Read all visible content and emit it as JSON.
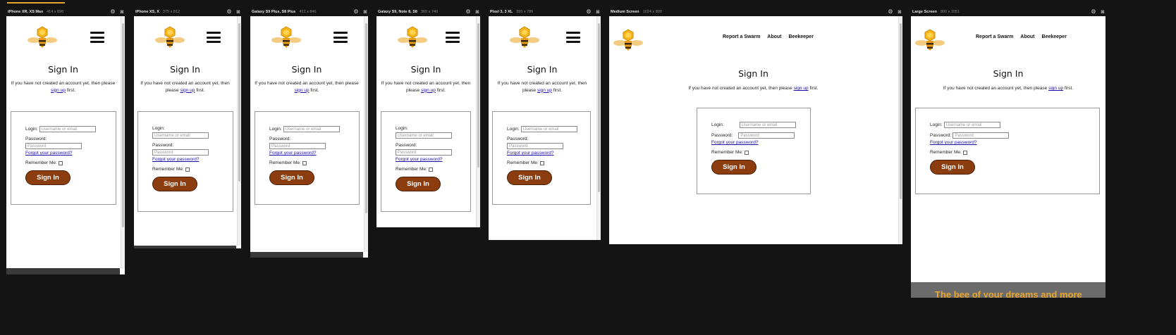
{
  "devices": [
    {
      "name": "iPhone XR, XS Max",
      "dims": "414 x 896"
    },
    {
      "name": "iPhone XS, X",
      "dims": "375 x 812"
    },
    {
      "name": "Galaxy S9 Plus, S8 Plus",
      "dims": "412 x 846"
    },
    {
      "name": "Galaxy S9, Note 8, S8",
      "dims": "360 x 740"
    },
    {
      "name": "Pixel 3, 3 XL",
      "dims": "393 x 786"
    },
    {
      "name": "Medium Screen",
      "dims": "1024 x 800"
    },
    {
      "name": "Large Screen",
      "dims": "800 x 1051"
    }
  ],
  "site": {
    "nav_links": [
      "Report a Swarm",
      "About",
      "Beekeeper"
    ],
    "title": "Sign In",
    "intro_before": "If you have not created an account yet, then please ",
    "intro_link": "sign up",
    "intro_after": " first.",
    "login_label": "Login:",
    "login_placeholder": "Username or email",
    "password_label": "Password:",
    "password_placeholder": "Password",
    "forgot": "Forgot your password?",
    "remember": "Remember Me:",
    "button": "Sign In",
    "footer_partial": "The bee of your dreams and more"
  },
  "icons": {
    "logo": "bee-logo-icon",
    "menu": "hamburger-menu-icon",
    "settings": "gear-icon",
    "screenshot": "camera-icon"
  },
  "colors": {
    "button": "#8b3d10",
    "active_tab": "#e8a530",
    "link": "#1a0dab"
  }
}
